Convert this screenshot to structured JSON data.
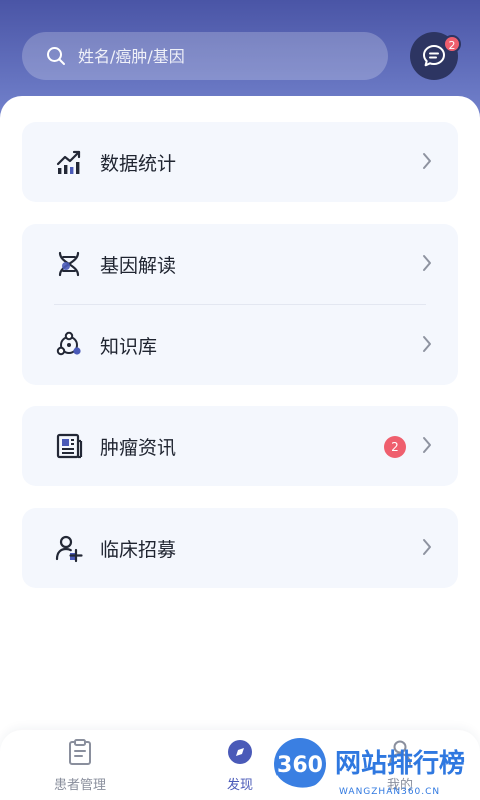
{
  "header": {
    "search_placeholder": "姓名/癌肿/基因",
    "message_badge": "2"
  },
  "menu": {
    "stats": {
      "label": "数据统计"
    },
    "gene": {
      "label": "基因解读"
    },
    "knowledge": {
      "label": "知识库"
    },
    "news": {
      "label": "肿瘤资讯",
      "badge": "2"
    },
    "recruit": {
      "label": "临床招募"
    }
  },
  "tabs": {
    "patients": "患者管理",
    "discover": "发现",
    "mine": "我的"
  },
  "watermark": {
    "number": "360",
    "title": "网站排行榜",
    "url": "WANGZHAN360.CN"
  },
  "colors": {
    "header_top": "#4a55a6",
    "accent": "#4a5ab8",
    "badge": "#ef5f6e",
    "card_bg": "#f4f7fd"
  }
}
